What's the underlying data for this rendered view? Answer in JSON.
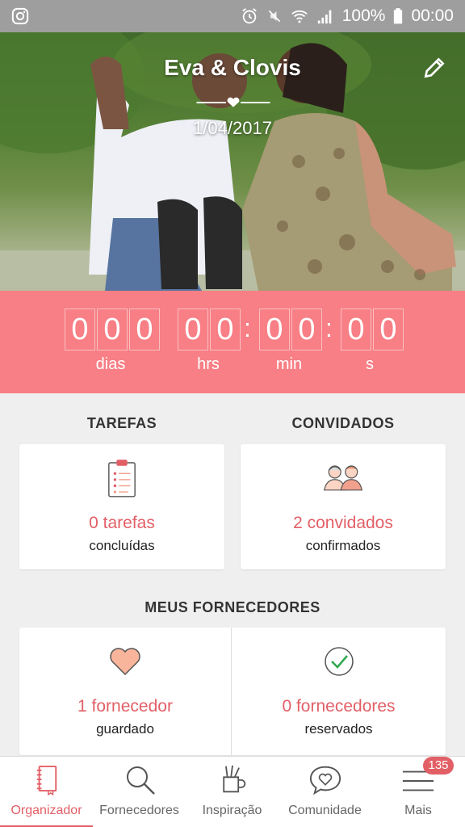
{
  "status_bar": {
    "battery": "100%",
    "time": "00:00"
  },
  "hero": {
    "couple_names": "Eva & Clovis",
    "wedding_date": "1/04/2017"
  },
  "countdown": {
    "days": [
      "0",
      "0",
      "0"
    ],
    "hours": [
      "0",
      "0"
    ],
    "minutes": [
      "0",
      "0"
    ],
    "seconds": [
      "0",
      "0"
    ],
    "separator": ":",
    "labels": {
      "days": "dias",
      "hours": "hrs",
      "minutes": "min",
      "seconds": "s"
    }
  },
  "tasks": {
    "title": "TAREFAS",
    "count": "0 tarefas",
    "caption": "concluídas"
  },
  "guests": {
    "title": "CONVIDADOS",
    "count": "2 convidados",
    "caption": "confirmados"
  },
  "vendors": {
    "title": "MEUS FORNECEDORES",
    "saved": {
      "count": "1 fornecedor",
      "caption": "guardado"
    },
    "booked": {
      "count": "0 fornecedores",
      "caption": "reservados"
    }
  },
  "nav": {
    "items": [
      {
        "label": "Organizador",
        "icon": "notebook-icon"
      },
      {
        "label": "Fornecedores",
        "icon": "search-icon"
      },
      {
        "label": "Inspiração",
        "icon": "pencil-cup-icon"
      },
      {
        "label": "Comunidade",
        "icon": "chat-heart-icon"
      },
      {
        "label": "Mais",
        "icon": "menu-icon"
      }
    ],
    "badge": "135"
  },
  "colors": {
    "accent": "#e25f66",
    "countdown_bg": "#f77f85",
    "status_bar": "#9e9e9e"
  }
}
